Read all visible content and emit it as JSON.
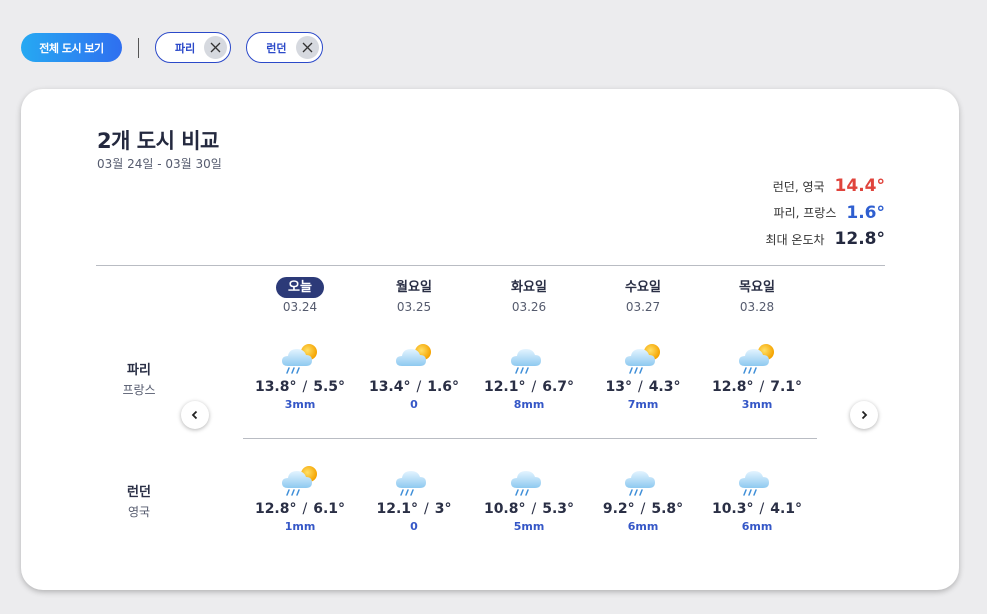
{
  "topbar": {
    "all_label": "전체 도시 보기",
    "chips": [
      {
        "label": "파리"
      },
      {
        "label": "런던"
      }
    ]
  },
  "card": {
    "title": "2개 도시 비교",
    "date_range": "03월 24일 - 03월 30일",
    "summary": [
      {
        "label": "런던, 영국",
        "value": "14.4°",
        "color": "#e0443c"
      },
      {
        "label": "파리, 프랑스",
        "value": "1.6°",
        "color": "#2f5fd0"
      },
      {
        "label": "최대 온도차",
        "value": "12.8°",
        "color": "#24293f"
      }
    ]
  },
  "days": [
    {
      "name": "오늘",
      "date": "03.24",
      "today": true
    },
    {
      "name": "월요일",
      "date": "03.25"
    },
    {
      "name": "화요일",
      "date": "03.26"
    },
    {
      "name": "수요일",
      "date": "03.27"
    },
    {
      "name": "목요일",
      "date": "03.28"
    }
  ],
  "cities": [
    {
      "name": "파리",
      "country": "프랑스",
      "forecast": [
        {
          "max": "13.8°",
          "min": "5.5°",
          "precip": "3mm",
          "icon": "sun-cloud-rain-icon"
        },
        {
          "max": "13.4°",
          "min": "1.6°",
          "precip": "0",
          "icon": "sun-cloud-icon"
        },
        {
          "max": "12.1°",
          "min": "6.7°",
          "precip": "8mm",
          "icon": "cloud-rain-icon"
        },
        {
          "max": "13°",
          "min": "4.3°",
          "precip": "7mm",
          "icon": "sun-cloud-rain-icon"
        },
        {
          "max": "12.8°",
          "min": "7.1°",
          "precip": "3mm",
          "icon": "sun-cloud-rain-icon"
        }
      ]
    },
    {
      "name": "런던",
      "country": "영국",
      "forecast": [
        {
          "max": "12.8°",
          "min": "6.1°",
          "precip": "1mm",
          "icon": "sun-cloud-rain-icon"
        },
        {
          "max": "12.1°",
          "min": "3°",
          "precip": "0",
          "icon": "cloud-rain-icon"
        },
        {
          "max": "10.8°",
          "min": "5.3°",
          "precip": "5mm",
          "icon": "cloud-rain-icon"
        },
        {
          "max": "9.2°",
          "min": "5.8°",
          "precip": "6mm",
          "icon": "cloud-rain-icon"
        },
        {
          "max": "10.3°",
          "min": "4.1°",
          "precip": "6mm",
          "icon": "cloud-rain-icon"
        }
      ]
    }
  ],
  "colors": {
    "accent": "#2b49c9",
    "today_badge": "#2c3a78",
    "precip": "#3557c7"
  }
}
